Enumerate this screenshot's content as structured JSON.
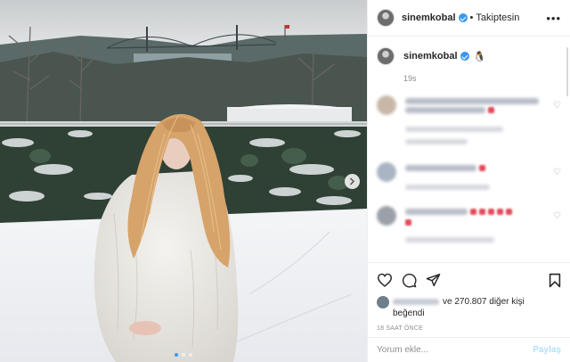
{
  "post": {
    "author": {
      "username": "sinemkobal",
      "verified": true,
      "follow_separator": "•",
      "follow_status": "Takiptesin"
    },
    "caption": {
      "username": "sinemkobal",
      "emoji": "🐧",
      "time": "19s"
    },
    "likes": {
      "text": "ve 270.807 diğer kişi",
      "suffix": "beğendi"
    },
    "posted_ago": "18 SAAT ÖNCE",
    "comment_box": {
      "placeholder": "Yorum ekle...",
      "submit_label": "Paylaş"
    },
    "icons": {
      "like": "heart-icon",
      "comment": "comment-icon",
      "share": "share-icon",
      "save": "bookmark-icon",
      "more": "more-icon",
      "next": "chevron-right-icon"
    },
    "carousel": {
      "slides": 3,
      "active": 1
    },
    "colors": {
      "accent": "#3897f0",
      "share_disabled": "#b2dffc",
      "muted": "#8e8e8e"
    }
  }
}
